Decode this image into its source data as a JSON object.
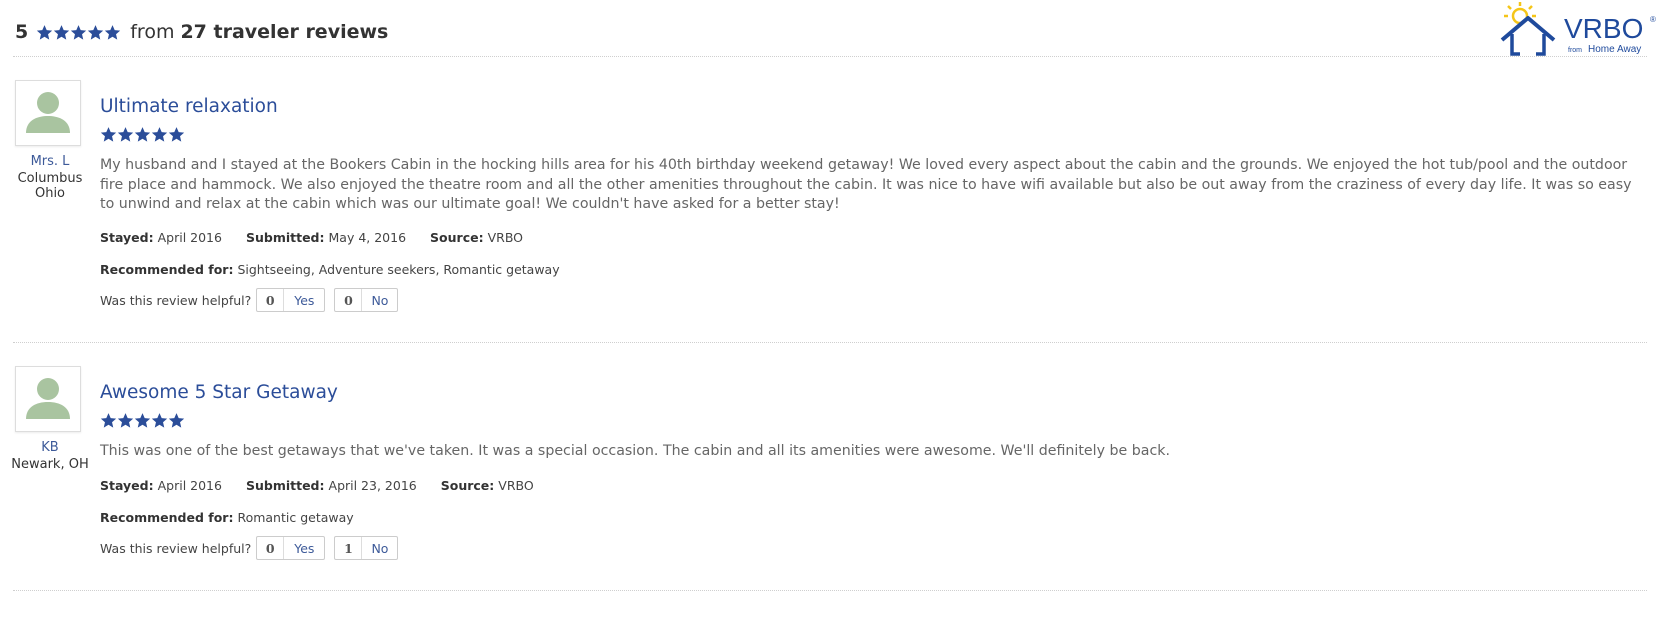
{
  "summary": {
    "score": "5",
    "star_count": 5,
    "from_text": "from",
    "count_text": "27 traveler reviews",
    "star_color": "#2b4d99"
  },
  "logo": {
    "brand": "VRBO",
    "registered_mark": "®",
    "from_text": "from",
    "home_text": "Home",
    "away_text": "Away",
    "brand_color": "#1f4a9c",
    "sun_color": "#f5c518"
  },
  "reviews": [
    {
      "reviewer_name": "Mrs. L",
      "reviewer_location_line1": "Columbus",
      "reviewer_location_line2": "Ohio",
      "title": "Ultimate relaxation",
      "rating": 5,
      "body": "My husband and I stayed at the Bookers Cabin in the hocking hills area for his 40th birthday weekend getaway! We loved every aspect about the cabin and the grounds. We enjoyed the hot tub/pool and the outdoor fire place and hammock. We also enjoyed the theatre room and all the other amenities throughout the cabin. It was nice to have wifi available but also be out away from the craziness of every day life. It was so easy to unwind and relax at the cabin which was our ultimate goal! We couldn't have asked for a better stay!",
      "stayed_label": "Stayed:",
      "stayed": "April 2016",
      "submitted_label": "Submitted:",
      "submitted": "May 4, 2016",
      "source_label": "Source:",
      "source": "VRBO",
      "recommended_label": "Recommended for:",
      "recommended": "Sightseeing, Adventure seekers, Romantic getaway",
      "helpful_label": "Was this review helpful?",
      "yes_count": "0",
      "yes_label": "Yes",
      "no_count": "0",
      "no_label": "No"
    },
    {
      "reviewer_name": "KB",
      "reviewer_location_line1": "Newark, OH",
      "reviewer_location_line2": "",
      "title": "Awesome 5 Star Getaway",
      "rating": 5,
      "body": "This was one of the best getaways that we've taken.  It was a special occasion.  The cabin and all its amenities were awesome.  We'll definitely be back.",
      "stayed_label": "Stayed:",
      "stayed": "April 2016",
      "submitted_label": "Submitted:",
      "submitted": "April 23, 2016",
      "source_label": "Source:",
      "source": "VRBO",
      "recommended_label": "Recommended for:",
      "recommended": "Romantic getaway",
      "helpful_label": "Was this review helpful?",
      "yes_count": "0",
      "yes_label": "Yes",
      "no_count": "1",
      "no_label": "No"
    }
  ],
  "colors": {
    "title": "#2b4d99",
    "link": "#3d5a99",
    "body_text": "#666666",
    "avatar_figure": "#a9c4a0",
    "divider": "#cfcfcf"
  }
}
